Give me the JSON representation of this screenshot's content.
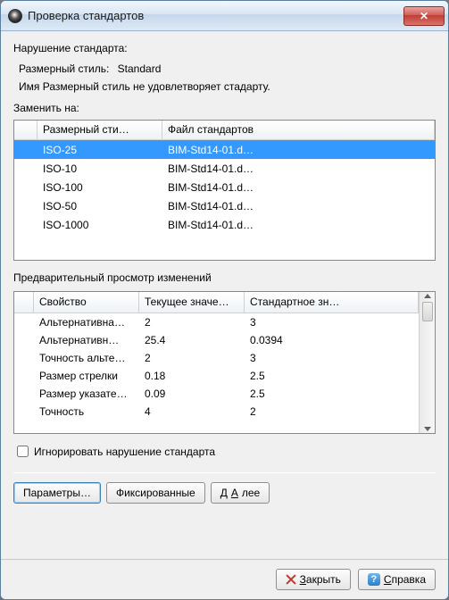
{
  "title": "Проверка стандартов",
  "violation": {
    "header": "Нарушение стандарта:",
    "style_label": "Размерный стиль:",
    "style_value": "Standard",
    "message": "Имя Размерный стиль не удовлетворяет стадарту."
  },
  "replace": {
    "label": "Заменить на:",
    "columns": [
      "",
      "Размерный сти…",
      "Файл стандартов"
    ],
    "rows": [
      {
        "style": "ISO-25",
        "file": "BIM-Std14-01.d…",
        "selected": true
      },
      {
        "style": "ISO-10",
        "file": "BIM-Std14-01.d…",
        "selected": false
      },
      {
        "style": "ISO-100",
        "file": "BIM-Std14-01.d…",
        "selected": false
      },
      {
        "style": "ISO-50",
        "file": "BIM-Std14-01.d…",
        "selected": false
      },
      {
        "style": "ISO-1000",
        "file": "BIM-Std14-01.d…",
        "selected": false
      }
    ]
  },
  "preview": {
    "label": "Предварительный просмотр изменений",
    "columns": [
      "",
      "Свойство",
      "Текущее значе…",
      "Стандартное зн…"
    ],
    "rows": [
      {
        "prop": "Альтернативна…",
        "cur": "2",
        "std": "3"
      },
      {
        "prop": "Альтернативн…",
        "cur": "25.4",
        "std": "0.0394"
      },
      {
        "prop": "Точность альте…",
        "cur": "2",
        "std": "3"
      },
      {
        "prop": "Размер стрелки",
        "cur": "0.18",
        "std": "2.5"
      },
      {
        "prop": "Размер указате…",
        "cur": "0.09",
        "std": "2.5"
      },
      {
        "prop": "Точность",
        "cur": "4",
        "std": "2"
      }
    ]
  },
  "checkbox": {
    "label": "Игнорировать нарушение стандарта",
    "checked": false
  },
  "buttons": {
    "params": "Параметры…",
    "fixed": "Фиксированные",
    "next_prefix": "Д",
    "next_underline": "А",
    "next_suffix": "лее",
    "close_prefix": "",
    "close_underline": "З",
    "close_suffix": "акрыть",
    "help_prefix": "",
    "help_underline": "С",
    "help_suffix": "правка"
  }
}
